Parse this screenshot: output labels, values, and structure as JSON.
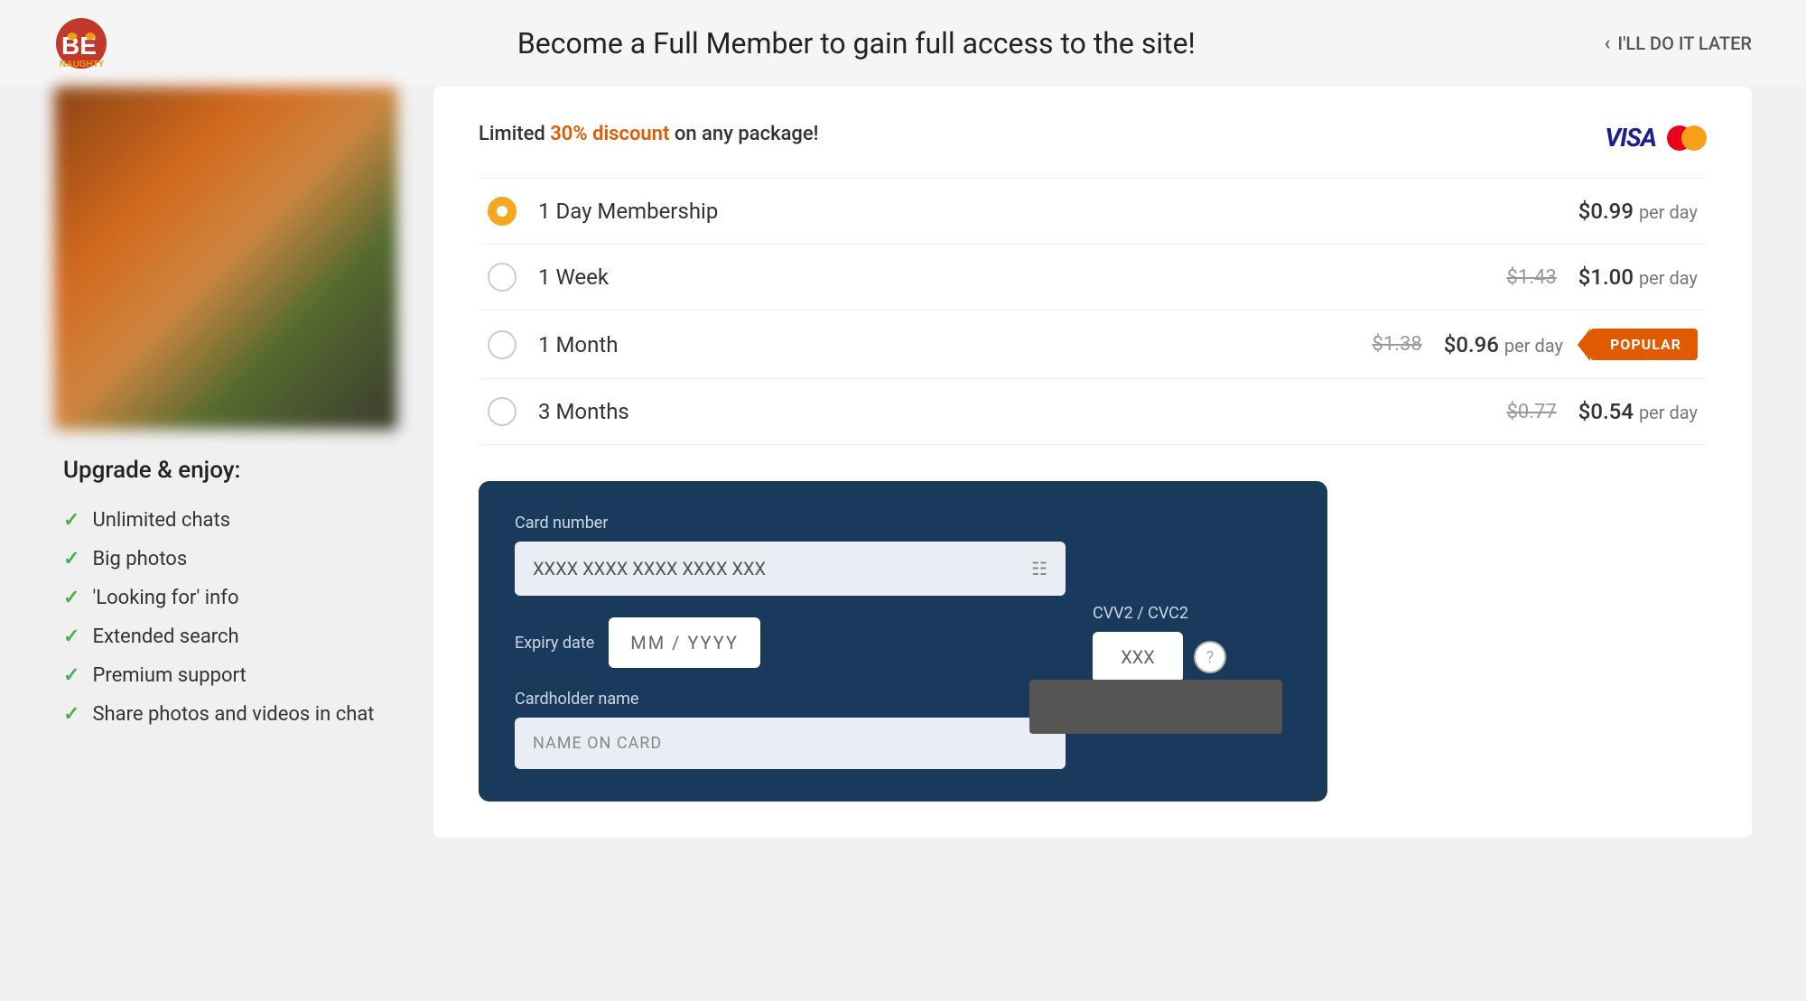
{
  "header": {
    "title": "Become a Full Member to gain full access to the site!",
    "skip_label": "I'LL DO IT LATER"
  },
  "sidebar": {
    "upgrade_title": "Upgrade & enjoy:",
    "features": [
      {
        "label": "Unlimited chats"
      },
      {
        "label": "Big photos"
      },
      {
        "label": "'Looking for' info"
      },
      {
        "label": "Extended search"
      },
      {
        "label": "Premium support"
      },
      {
        "label": "Share photos and videos in chat"
      }
    ]
  },
  "pricing": {
    "discount_text": "Limited ",
    "discount_highlight": "30% discount",
    "discount_suffix": " on any package!",
    "plans": [
      {
        "name": "1 Day Membership",
        "original_price": "",
        "current_price": "$0.99",
        "per_day": "per day",
        "selected": true,
        "popular": false
      },
      {
        "name": "1 Week",
        "original_price": "$1.43",
        "current_price": "$1.00",
        "per_day": "per day",
        "selected": false,
        "popular": false
      },
      {
        "name": "1 Month",
        "original_price": "$1.38",
        "current_price": "$0.96",
        "per_day": "per day",
        "selected": false,
        "popular": true
      },
      {
        "name": "3 Months",
        "original_price": "$0.77",
        "current_price": "$0.54",
        "per_day": "per day",
        "selected": false,
        "popular": false
      }
    ]
  },
  "payment": {
    "card_number_label": "Card number",
    "card_number_placeholder": "XXXX XXXX XXXX XXXX XXX",
    "expiry_label": "Expiry date",
    "expiry_placeholder": "MM  /  YYYY",
    "cardholder_label": "Cardholder name",
    "cardholder_placeholder": "NAME ON CARD",
    "cvv_label": "CVV2 / CVC2",
    "cvv_placeholder": "XXX",
    "popular_badge": "POPULAR"
  },
  "logos": {
    "visa": "VISA",
    "mastercard": "MC"
  }
}
